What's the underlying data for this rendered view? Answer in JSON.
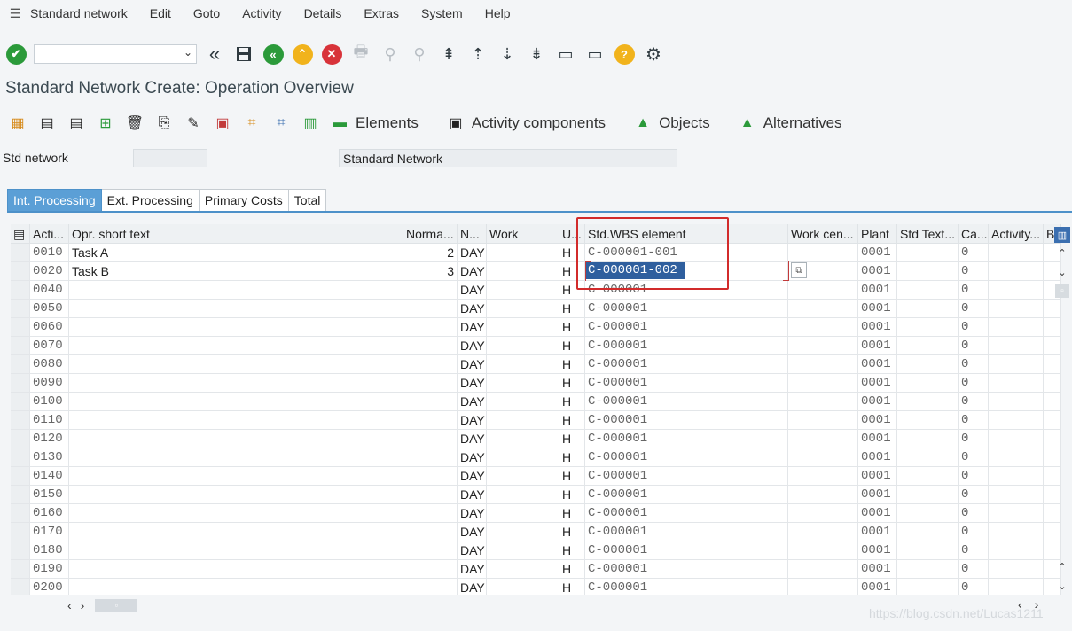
{
  "menu": {
    "items": [
      "Standard network",
      "Edit",
      "Goto",
      "Activity",
      "Details",
      "Extras",
      "System",
      "Help"
    ]
  },
  "toolbar": {
    "command_value": ""
  },
  "page": {
    "title": "Standard Network Create: Operation Overview"
  },
  "app_toolbar": {
    "elements": "Elements",
    "activity_components": "Activity components",
    "objects": "Objects",
    "alternatives": "Alternatives"
  },
  "header": {
    "std_network_label": "Std network",
    "std_network_value": "",
    "description": "Standard Network"
  },
  "tabs": [
    "Int. Processing",
    "Ext. Processing",
    "Primary Costs",
    "Total"
  ],
  "grid": {
    "columns": [
      "Acti...",
      "Opr. short text",
      "Norma...",
      "N...",
      "Work",
      "U...",
      "Std.WBS element",
      "Work cen...",
      "Plant",
      "Std Text...",
      "Ca...",
      "Activity...",
      "B"
    ],
    "rows": [
      {
        "act": "0010",
        "text": "Task A",
        "norm": "2",
        "unit": "DAY",
        "work": "",
        "u": "H",
        "wbs": "C-000001-001",
        "wc": "",
        "plant": "0001",
        "stdtext": "",
        "ca": "0"
      },
      {
        "act": "0020",
        "text": "Task B",
        "norm": "3",
        "unit": "DAY",
        "work": "",
        "u": "H",
        "wbs": "C-000001-002",
        "wc": "",
        "plant": "0001",
        "stdtext": "",
        "ca": "0"
      },
      {
        "act": "0040",
        "text": "",
        "norm": "",
        "unit": "DAY",
        "work": "",
        "u": "H",
        "wbs": "C-000001",
        "wc": "",
        "plant": "0001",
        "stdtext": "",
        "ca": "0"
      },
      {
        "act": "0050",
        "text": "",
        "norm": "",
        "unit": "DAY",
        "work": "",
        "u": "H",
        "wbs": "C-000001",
        "wc": "",
        "plant": "0001",
        "stdtext": "",
        "ca": "0"
      },
      {
        "act": "0060",
        "text": "",
        "norm": "",
        "unit": "DAY",
        "work": "",
        "u": "H",
        "wbs": "C-000001",
        "wc": "",
        "plant": "0001",
        "stdtext": "",
        "ca": "0"
      },
      {
        "act": "0070",
        "text": "",
        "norm": "",
        "unit": "DAY",
        "work": "",
        "u": "H",
        "wbs": "C-000001",
        "wc": "",
        "plant": "0001",
        "stdtext": "",
        "ca": "0"
      },
      {
        "act": "0080",
        "text": "",
        "norm": "",
        "unit": "DAY",
        "work": "",
        "u": "H",
        "wbs": "C-000001",
        "wc": "",
        "plant": "0001",
        "stdtext": "",
        "ca": "0"
      },
      {
        "act": "0090",
        "text": "",
        "norm": "",
        "unit": "DAY",
        "work": "",
        "u": "H",
        "wbs": "C-000001",
        "wc": "",
        "plant": "0001",
        "stdtext": "",
        "ca": "0"
      },
      {
        "act": "0100",
        "text": "",
        "norm": "",
        "unit": "DAY",
        "work": "",
        "u": "H",
        "wbs": "C-000001",
        "wc": "",
        "plant": "0001",
        "stdtext": "",
        "ca": "0"
      },
      {
        "act": "0110",
        "text": "",
        "norm": "",
        "unit": "DAY",
        "work": "",
        "u": "H",
        "wbs": "C-000001",
        "wc": "",
        "plant": "0001",
        "stdtext": "",
        "ca": "0"
      },
      {
        "act": "0120",
        "text": "",
        "norm": "",
        "unit": "DAY",
        "work": "",
        "u": "H",
        "wbs": "C-000001",
        "wc": "",
        "plant": "0001",
        "stdtext": "",
        "ca": "0"
      },
      {
        "act": "0130",
        "text": "",
        "norm": "",
        "unit": "DAY",
        "work": "",
        "u": "H",
        "wbs": "C-000001",
        "wc": "",
        "plant": "0001",
        "stdtext": "",
        "ca": "0"
      },
      {
        "act": "0140",
        "text": "",
        "norm": "",
        "unit": "DAY",
        "work": "",
        "u": "H",
        "wbs": "C-000001",
        "wc": "",
        "plant": "0001",
        "stdtext": "",
        "ca": "0"
      },
      {
        "act": "0150",
        "text": "",
        "norm": "",
        "unit": "DAY",
        "work": "",
        "u": "H",
        "wbs": "C-000001",
        "wc": "",
        "plant": "0001",
        "stdtext": "",
        "ca": "0"
      },
      {
        "act": "0160",
        "text": "",
        "norm": "",
        "unit": "DAY",
        "work": "",
        "u": "H",
        "wbs": "C-000001",
        "wc": "",
        "plant": "0001",
        "stdtext": "",
        "ca": "0"
      },
      {
        "act": "0170",
        "text": "",
        "norm": "",
        "unit": "DAY",
        "work": "",
        "u": "H",
        "wbs": "C-000001",
        "wc": "",
        "plant": "0001",
        "stdtext": "",
        "ca": "0"
      },
      {
        "act": "0180",
        "text": "",
        "norm": "",
        "unit": "DAY",
        "work": "",
        "u": "H",
        "wbs": "C-000001",
        "wc": "",
        "plant": "0001",
        "stdtext": "",
        "ca": "0"
      },
      {
        "act": "0190",
        "text": "",
        "norm": "",
        "unit": "DAY",
        "work": "",
        "u": "H",
        "wbs": "C-000001",
        "wc": "",
        "plant": "0001",
        "stdtext": "",
        "ca": "0"
      },
      {
        "act": "0200",
        "text": "",
        "norm": "",
        "unit": "DAY",
        "work": "",
        "u": "H",
        "wbs": "C-000001",
        "wc": "",
        "plant": "0001",
        "stdtext": "",
        "ca": "0"
      }
    ]
  },
  "watermark": "https://blog.csdn.net/Lucas1211",
  "colors": {
    "tab_active": "#5b9fd6",
    "highlight_box": "#d22b2b",
    "selection": "#2f5f9e"
  }
}
